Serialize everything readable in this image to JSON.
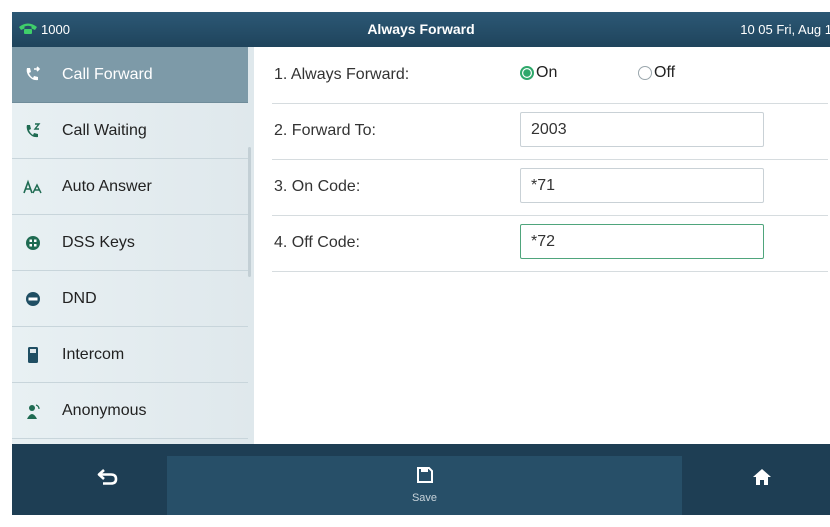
{
  "status_bar": {
    "account": "1000",
    "title": "Always Forward",
    "datetime": "10 05 Fri, Aug 1"
  },
  "sidebar": {
    "items": [
      {
        "label": "Call Forward",
        "icon": "call-forward-icon",
        "active": true
      },
      {
        "label": "Call Waiting",
        "icon": "call-waiting-icon",
        "active": false
      },
      {
        "label": "Auto Answer",
        "icon": "auto-answer-icon",
        "active": false
      },
      {
        "label": "DSS Keys",
        "icon": "dss-keys-icon",
        "active": false
      },
      {
        "label": "DND",
        "icon": "dnd-icon",
        "active": false
      },
      {
        "label": "Intercom",
        "icon": "intercom-icon",
        "active": false
      },
      {
        "label": "Anonymous",
        "icon": "anonymous-icon",
        "active": false
      }
    ]
  },
  "form": {
    "always_forward": {
      "label": "1. Always Forward:",
      "on_label": "On",
      "off_label": "Off",
      "selected": "On"
    },
    "forward_to": {
      "label": "2. Forward To:",
      "value": "2003"
    },
    "on_code": {
      "label": "3. On Code:",
      "value": "*71"
    },
    "off_code": {
      "label": "4. Off Code:",
      "value": "*72"
    }
  },
  "softkeys": {
    "back_icon": "back-arrow-icon",
    "save_label": "Save",
    "save_icon": "save-icon",
    "home_icon": "home-icon"
  },
  "colors": {
    "accent": "#2fa86b",
    "header": "#2c5875",
    "active_item": "#7d9aa8"
  }
}
